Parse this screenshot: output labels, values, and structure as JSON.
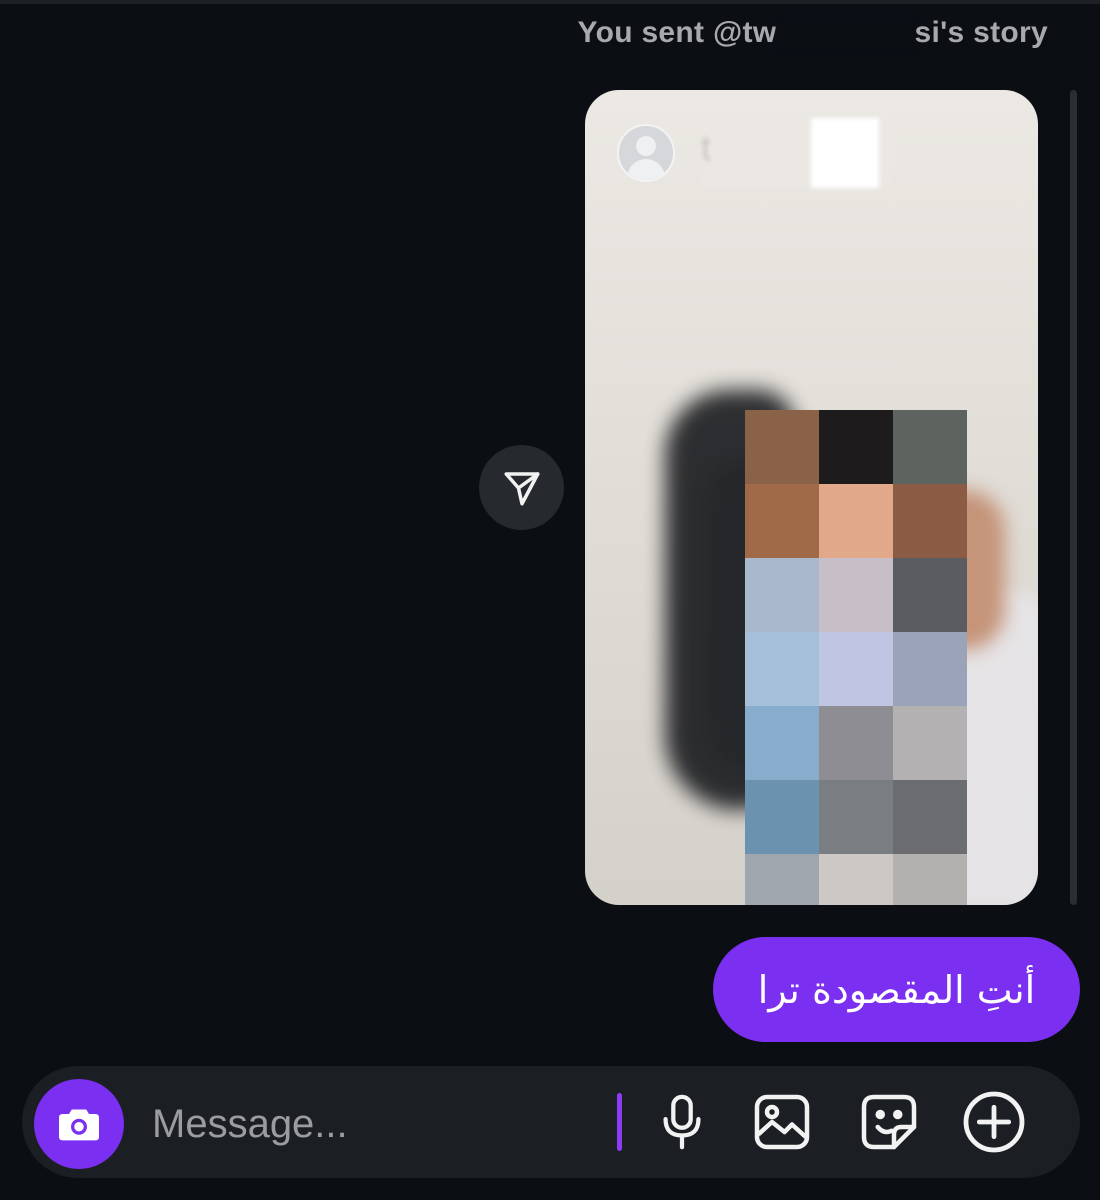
{
  "story": {
    "caption_prefix": "You sent @tw",
    "caption_suffix": "si's story",
    "username_partial": "t"
  },
  "message": {
    "text": "أنتِ المقصودة ترا"
  },
  "composer": {
    "placeholder": "Message..."
  },
  "icons": {
    "share": "paper-plane-icon",
    "camera": "camera-icon",
    "mic": "microphone-icon",
    "gallery": "image-icon",
    "sticker": "sticker-icon",
    "add": "plus-circle-icon"
  },
  "colors": {
    "background": "#0b0f14",
    "accent": "#7b2ff0",
    "composer_bg": "#1b1f23"
  }
}
